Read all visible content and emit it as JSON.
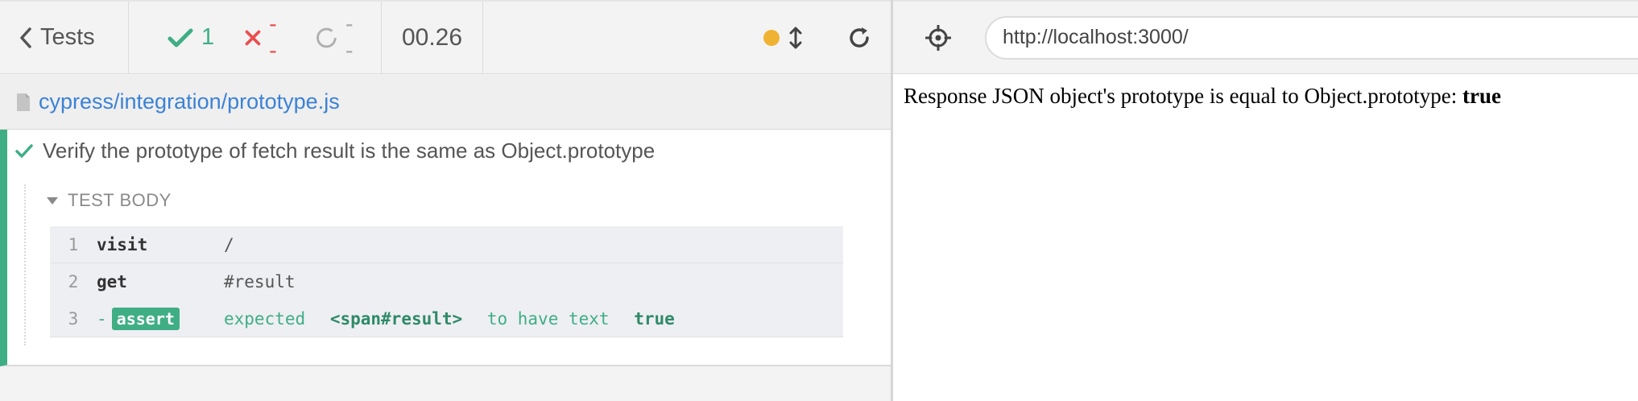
{
  "reporter": {
    "tests_label": "Tests",
    "stats": {
      "passed": "1",
      "failed": "--",
      "pending": "--"
    },
    "duration": "00.26",
    "status_color": "#f0b232",
    "spec_path": "cypress/integration/prototype.js",
    "test": {
      "title": "Verify the prototype of fetch result is the same as Object.prototype",
      "hook_label": "TEST BODY",
      "commands": [
        {
          "num": "1",
          "name": "visit",
          "message": "/"
        },
        {
          "num": "2",
          "name": "get",
          "message": "#result"
        },
        {
          "num": "3",
          "name": "-",
          "badge": "assert",
          "assert_parts": [
            "expected",
            "<span#result>",
            "to have text",
            "true"
          ]
        }
      ]
    }
  },
  "aut": {
    "url": "http://localhost:3000/",
    "body_text": "Response JSON object's prototype is equal to Object.prototype: ",
    "body_value": "true"
  },
  "colors": {
    "passed": "#3fae85",
    "failed": "#e94f4f",
    "link": "#3b82d6"
  },
  "icons": [
    "chevron-left-icon",
    "check-icon",
    "x-icon",
    "spinner-icon",
    "resize-icon",
    "reload-icon",
    "file-icon",
    "caret-down-icon",
    "crosshair-icon"
  ]
}
